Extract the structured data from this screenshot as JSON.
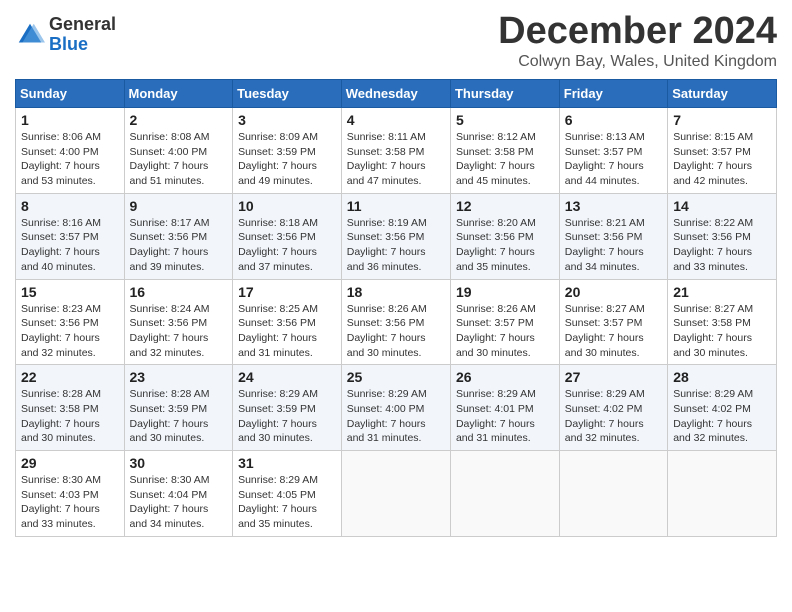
{
  "logo": {
    "general": "General",
    "blue": "Blue"
  },
  "title": "December 2024",
  "location": "Colwyn Bay, Wales, United Kingdom",
  "days_of_week": [
    "Sunday",
    "Monday",
    "Tuesday",
    "Wednesday",
    "Thursday",
    "Friday",
    "Saturday"
  ],
  "weeks": [
    [
      {
        "day": "1",
        "sunrise": "8:06 AM",
        "sunset": "4:00 PM",
        "daylight": "7 hours and 53 minutes."
      },
      {
        "day": "2",
        "sunrise": "8:08 AM",
        "sunset": "4:00 PM",
        "daylight": "7 hours and 51 minutes."
      },
      {
        "day": "3",
        "sunrise": "8:09 AM",
        "sunset": "3:59 PM",
        "daylight": "7 hours and 49 minutes."
      },
      {
        "day": "4",
        "sunrise": "8:11 AM",
        "sunset": "3:58 PM",
        "daylight": "7 hours and 47 minutes."
      },
      {
        "day": "5",
        "sunrise": "8:12 AM",
        "sunset": "3:58 PM",
        "daylight": "7 hours and 45 minutes."
      },
      {
        "day": "6",
        "sunrise": "8:13 AM",
        "sunset": "3:57 PM",
        "daylight": "7 hours and 44 minutes."
      },
      {
        "day": "7",
        "sunrise": "8:15 AM",
        "sunset": "3:57 PM",
        "daylight": "7 hours and 42 minutes."
      }
    ],
    [
      {
        "day": "8",
        "sunrise": "8:16 AM",
        "sunset": "3:57 PM",
        "daylight": "7 hours and 40 minutes."
      },
      {
        "day": "9",
        "sunrise": "8:17 AM",
        "sunset": "3:56 PM",
        "daylight": "7 hours and 39 minutes."
      },
      {
        "day": "10",
        "sunrise": "8:18 AM",
        "sunset": "3:56 PM",
        "daylight": "7 hours and 37 minutes."
      },
      {
        "day": "11",
        "sunrise": "8:19 AM",
        "sunset": "3:56 PM",
        "daylight": "7 hours and 36 minutes."
      },
      {
        "day": "12",
        "sunrise": "8:20 AM",
        "sunset": "3:56 PM",
        "daylight": "7 hours and 35 minutes."
      },
      {
        "day": "13",
        "sunrise": "8:21 AM",
        "sunset": "3:56 PM",
        "daylight": "7 hours and 34 minutes."
      },
      {
        "day": "14",
        "sunrise": "8:22 AM",
        "sunset": "3:56 PM",
        "daylight": "7 hours and 33 minutes."
      }
    ],
    [
      {
        "day": "15",
        "sunrise": "8:23 AM",
        "sunset": "3:56 PM",
        "daylight": "7 hours and 32 minutes."
      },
      {
        "day": "16",
        "sunrise": "8:24 AM",
        "sunset": "3:56 PM",
        "daylight": "7 hours and 32 minutes."
      },
      {
        "day": "17",
        "sunrise": "8:25 AM",
        "sunset": "3:56 PM",
        "daylight": "7 hours and 31 minutes."
      },
      {
        "day": "18",
        "sunrise": "8:26 AM",
        "sunset": "3:56 PM",
        "daylight": "7 hours and 30 minutes."
      },
      {
        "day": "19",
        "sunrise": "8:26 AM",
        "sunset": "3:57 PM",
        "daylight": "7 hours and 30 minutes."
      },
      {
        "day": "20",
        "sunrise": "8:27 AM",
        "sunset": "3:57 PM",
        "daylight": "7 hours and 30 minutes."
      },
      {
        "day": "21",
        "sunrise": "8:27 AM",
        "sunset": "3:58 PM",
        "daylight": "7 hours and 30 minutes."
      }
    ],
    [
      {
        "day": "22",
        "sunrise": "8:28 AM",
        "sunset": "3:58 PM",
        "daylight": "7 hours and 30 minutes."
      },
      {
        "day": "23",
        "sunrise": "8:28 AM",
        "sunset": "3:59 PM",
        "daylight": "7 hours and 30 minutes."
      },
      {
        "day": "24",
        "sunrise": "8:29 AM",
        "sunset": "3:59 PM",
        "daylight": "7 hours and 30 minutes."
      },
      {
        "day": "25",
        "sunrise": "8:29 AM",
        "sunset": "4:00 PM",
        "daylight": "7 hours and 31 minutes."
      },
      {
        "day": "26",
        "sunrise": "8:29 AM",
        "sunset": "4:01 PM",
        "daylight": "7 hours and 31 minutes."
      },
      {
        "day": "27",
        "sunrise": "8:29 AM",
        "sunset": "4:02 PM",
        "daylight": "7 hours and 32 minutes."
      },
      {
        "day": "28",
        "sunrise": "8:29 AM",
        "sunset": "4:02 PM",
        "daylight": "7 hours and 32 minutes."
      }
    ],
    [
      {
        "day": "29",
        "sunrise": "8:30 AM",
        "sunset": "4:03 PM",
        "daylight": "7 hours and 33 minutes."
      },
      {
        "day": "30",
        "sunrise": "8:30 AM",
        "sunset": "4:04 PM",
        "daylight": "7 hours and 34 minutes."
      },
      {
        "day": "31",
        "sunrise": "8:29 AM",
        "sunset": "4:05 PM",
        "daylight": "7 hours and 35 minutes."
      },
      null,
      null,
      null,
      null
    ]
  ]
}
